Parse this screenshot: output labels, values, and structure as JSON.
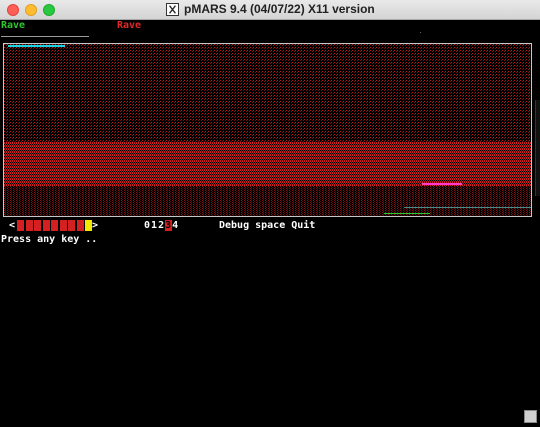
{
  "window": {
    "title": "pMARS 9.4 (04/07/22) X11 version"
  },
  "warriors": [
    {
      "name": "Rave",
      "color": "#2ec52e"
    },
    {
      "name": "Rave",
      "color": "#e02828"
    }
  ],
  "core": {
    "background_color": "#000000",
    "dominant_color": "#b81a1a",
    "accent_colors": [
      "#19d3e0",
      "#2ec52e",
      "#ff3bd1"
    ]
  },
  "status": {
    "left_arrow": "<",
    "right_arrow": ">",
    "progress_cells": 8,
    "highlight_color": "#f5e800",
    "bar_color": "#d42020",
    "speed_levels": [
      "0",
      "1",
      "2",
      "3",
      "4"
    ],
    "selected_speed": "3",
    "menu": "Debug space Quit"
  },
  "prompt": "Press any key .."
}
